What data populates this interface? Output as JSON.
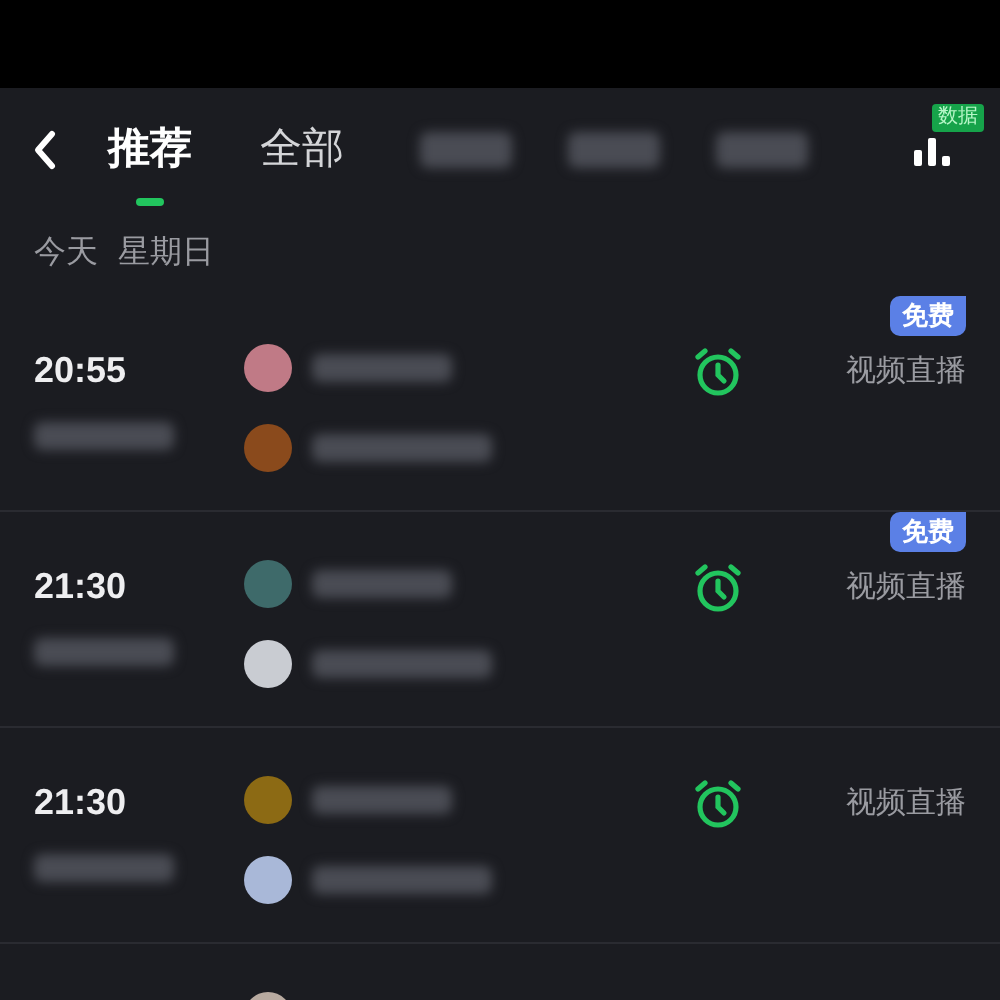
{
  "tabs": [
    {
      "label": "推荐",
      "selected": true
    },
    {
      "label": "全部",
      "selected": false
    }
  ],
  "data_badge": "数据",
  "date": {
    "day": "今天",
    "weekday": "星期日"
  },
  "matches": [
    {
      "time": "20:55",
      "free_badge": "免费",
      "broadcast": "视频直播",
      "teams": [
        {
          "color": "#c07a86"
        },
        {
          "color": "#8a4a1c"
        }
      ]
    },
    {
      "time": "21:30",
      "free_badge": "免费",
      "broadcast": "视频直播",
      "teams": [
        {
          "color": "#3e6a6a"
        },
        {
          "color": "#c9ccd2"
        }
      ]
    },
    {
      "time": "21:30",
      "broadcast": "视频直播",
      "teams": [
        {
          "color": "#8c6a14"
        },
        {
          "color": "#a9b8d8"
        }
      ]
    },
    {
      "teams": [
        {
          "color": "#b8aaa0"
        }
      ]
    }
  ]
}
